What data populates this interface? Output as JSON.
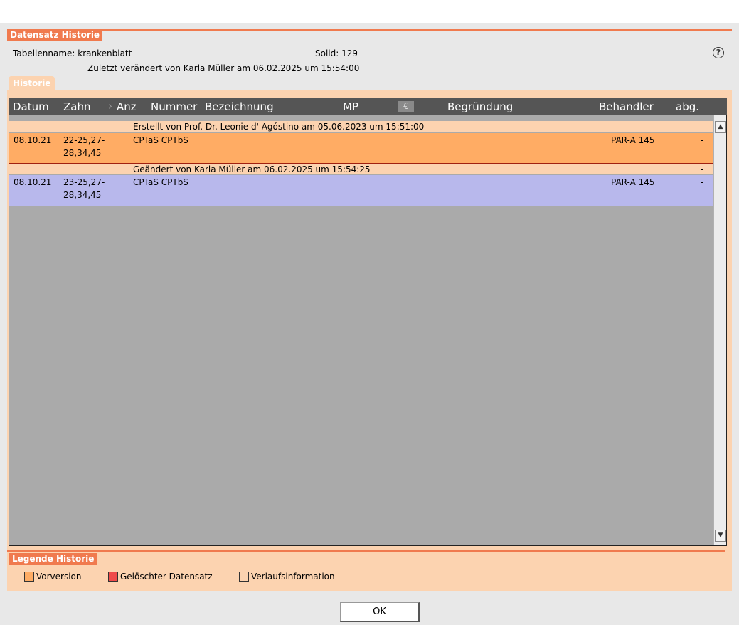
{
  "header": {
    "title": "Datensatz Historie",
    "table_label": "Tabellenname:",
    "table_name": "krankenblatt",
    "solid_label": "Solid:",
    "solid_value": "129",
    "last_changed": "Zuletzt verändert von Karla Müller am 06.02.2025 um 15:54:00",
    "help_symbol": "?"
  },
  "tab": {
    "label": "Historie"
  },
  "columns": {
    "datum": "Datum",
    "zahn": "Zahn",
    "anz": "Anz",
    "nummer": "Nummer",
    "bezeichnung": "Bezeichnung",
    "mp": "MP",
    "euro": "€",
    "begruendung": "Begründung",
    "behandler": "Behandler",
    "abg": "abg."
  },
  "rows": [
    {
      "type": "info",
      "text": "Erstellt von Prof. Dr. Leonie d' Agóstino am 05.06.2023 um 15:51:00",
      "abg": "-"
    },
    {
      "type": "data",
      "color": "#ffac64",
      "datum": "08.10.21",
      "zahn_line1": "22-25,27-",
      "zahn_line2": "28,34,45",
      "nummer": "CPTaS CPTbS",
      "behandler": "PAR-A 145",
      "abg": "-"
    },
    {
      "type": "info",
      "text": "Geändert von Karla Müller am 06.02.2025 um 15:54:25",
      "abg": "-"
    },
    {
      "type": "data",
      "color": "#b8b8ec",
      "datum": "08.10.21",
      "zahn_line1": "23-25,27-",
      "zahn_line2": "28,34,45",
      "nummer": "CPTaS CPTbS",
      "behandler": "PAR-A 145",
      "abg": "-"
    }
  ],
  "scrollbar": {
    "up": "▲",
    "down": "▼"
  },
  "legend": {
    "title": "Legende Historie",
    "items": [
      {
        "label": "Vorversion",
        "color": "#ffac64"
      },
      {
        "label": "Gelöschter Datensatz",
        "color": "#f04a4a"
      },
      {
        "label": "Verlaufsinformation",
        "color": "#fcd3b0"
      }
    ]
  },
  "footer": {
    "ok_label": "OK"
  },
  "colors": {
    "accent": "#f07a4e",
    "panel": "#fcd3b0",
    "header_bg": "#555555",
    "grid_bg": "#aaaaaa"
  }
}
